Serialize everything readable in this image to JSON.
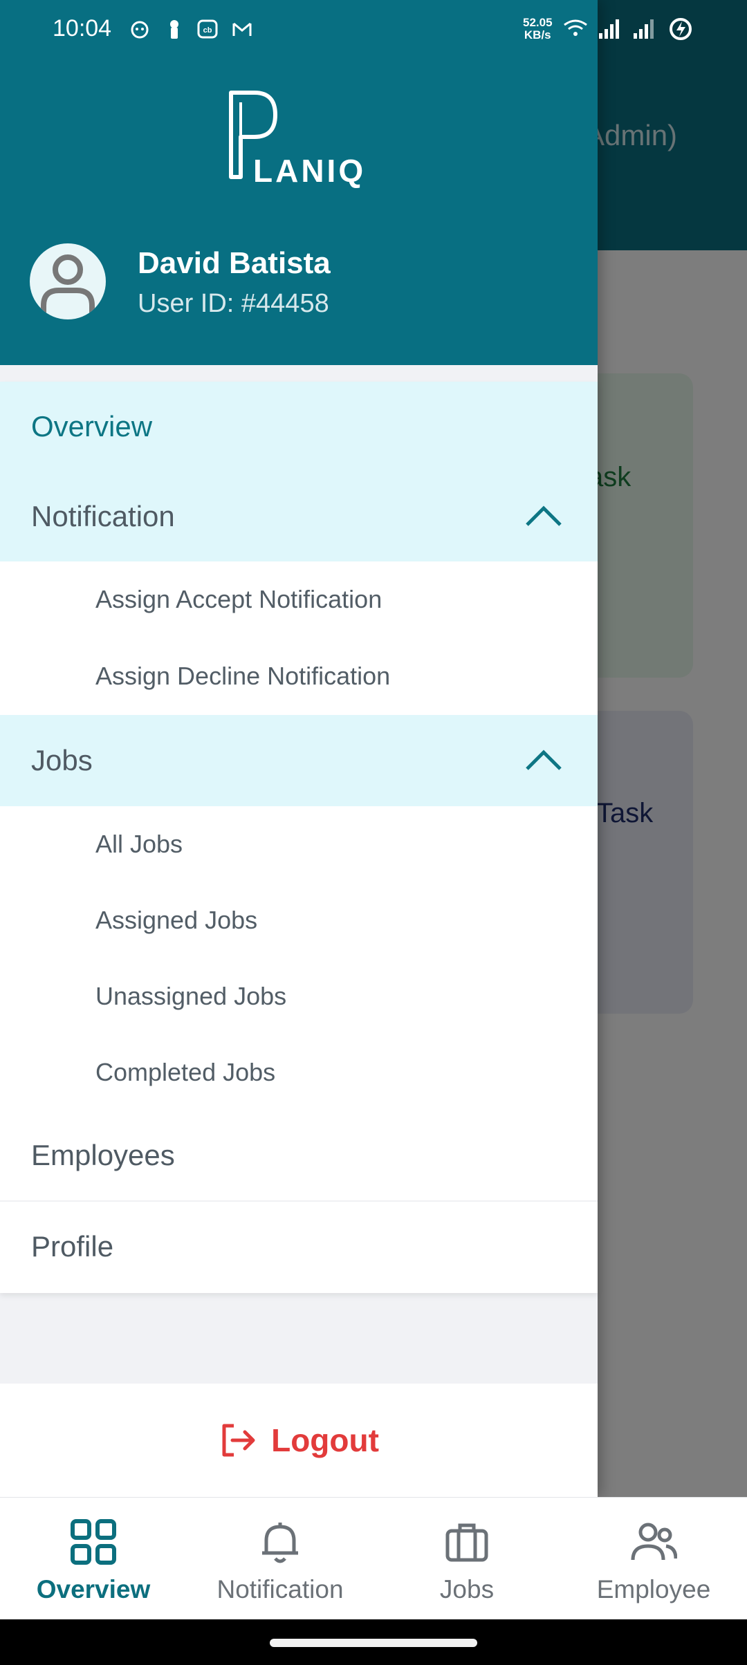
{
  "status_bar": {
    "time": "10:04",
    "speed_value": "52.05",
    "speed_unit": "KB/s"
  },
  "background": {
    "title_fragment": "Admin)",
    "card1_fragment": "ask",
    "card2_fragment": "Task"
  },
  "drawer": {
    "logo_text": "LANIQ",
    "user": {
      "name": "David Batista",
      "id_label": "User ID: #44458"
    },
    "menu": {
      "overview": "Overview",
      "notification": {
        "label": "Notification",
        "items": [
          "Assign Accept Notification",
          "Assign Decline Notification"
        ]
      },
      "jobs": {
        "label": "Jobs",
        "items": [
          "All Jobs",
          "Assigned Jobs",
          "Unassigned Jobs",
          "Completed Jobs"
        ]
      },
      "employees": "Employees",
      "profile": "Profile"
    },
    "logout": "Logout"
  },
  "bottom_nav": {
    "items": [
      {
        "label": "Overview",
        "icon": "grid-icon",
        "active": true
      },
      {
        "label": "Notification",
        "icon": "bell-icon",
        "active": false
      },
      {
        "label": "Jobs",
        "icon": "briefcase-icon",
        "active": false
      },
      {
        "label": "Employee",
        "icon": "people-icon",
        "active": false
      }
    ]
  },
  "colors": {
    "brand": "#086f82",
    "active_bg": "#dff7fb",
    "logout": "#e23b3b"
  }
}
